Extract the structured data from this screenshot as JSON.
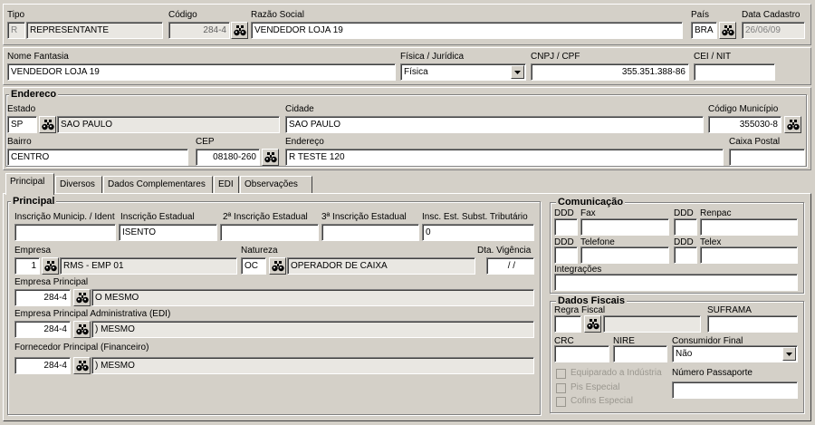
{
  "header": {
    "tipo_label": "Tipo",
    "tipo_code": "R",
    "tipo_value": "REPRESENTANTE",
    "codigo_label": "Código",
    "codigo_value": "284-4",
    "razao_label": "Razão Social",
    "razao_value": "VENDEDOR LOJA 19",
    "pais_label": "País",
    "pais_value": "BRA",
    "data_cadastro_label": "Data Cadastro",
    "data_cadastro_value": "26/06/09"
  },
  "row2": {
    "fantasia_label": "Nome Fantasia",
    "fantasia_value": "VENDEDOR LOJA 19",
    "fisica_label": "Física / Jurídica",
    "fisica_value": "Física",
    "cnpj_label": "CNPJ / CPF",
    "cnpj_value": "355.351.388-86",
    "cei_label": "CEI / NIT",
    "cei_value": ""
  },
  "endereco": {
    "title": "Endereco",
    "estado_label": "Estado",
    "estado_value": "SP",
    "estado_name": "SAO PAULO",
    "cidade_label": "Cidade",
    "cidade_value": "SAO PAULO",
    "cod_municipio_label": "Código Município",
    "cod_municipio_value": "355030-8",
    "bairro_label": "Bairro",
    "bairro_value": "CENTRO",
    "cep_label": "CEP",
    "cep_value": "08180-260",
    "endereco_label": "Endereço",
    "endereco_value": "R TESTE 120",
    "caixa_label": "Caixa Postal",
    "caixa_value": ""
  },
  "tabs": [
    {
      "label": "Principal"
    },
    {
      "label": "Diversos"
    },
    {
      "label": "Dados Complementares"
    },
    {
      "label": "EDI"
    },
    {
      "label": "Observações"
    }
  ],
  "principal": {
    "title": "Principal",
    "insc_municip_label": "Inscrição Municip. / Ident",
    "insc_municip_value": "",
    "insc_estadual_label": "Inscrição Estadual",
    "insc_estadual_value": "ISENTO",
    "insc2_label": "2ª Inscrição Estadual",
    "insc2_value": "",
    "insc3_label": "3ª Inscrição Estadual",
    "insc3_value": "",
    "insc_st_label": "Insc. Est. Subst. Tributário",
    "insc_st_value": "0",
    "empresa_label": "Empresa",
    "empresa_code": "1",
    "empresa_name": "RMS - EMP 01",
    "natureza_label": "Natureza",
    "natureza_code": "OC",
    "natureza_name": "OPERADOR DE CAIXA",
    "vigencia_label": "Dta. Vigência",
    "vigencia_value": " / /",
    "emp_principal_label": "Empresa Principal",
    "emp_principal_code": "284-4",
    "emp_principal_name": "O MESMO",
    "emp_admin_label": "Empresa Principal Administrativa (EDI)",
    "emp_admin_code": "284-4",
    "emp_admin_name": ") MESMO",
    "fornecedor_label": "Fornecedor Principal (Financeiro)",
    "fornecedor_code": "284-4",
    "fornecedor_name": ") MESMO"
  },
  "comunicacao": {
    "title": "Comunicação",
    "ddd_label": "DDD",
    "fax_label": "Fax",
    "renpac_label": "Renpac",
    "telefone_label": "Telefone",
    "telex_label": "Telex",
    "integracoes_label": "Integrações"
  },
  "fiscais": {
    "title": "Dados Fiscais",
    "regra_label": "Regra Fiscal",
    "suframa_label": "SUFRAMA",
    "crc_label": "CRC",
    "nire_label": "NIRE",
    "consumidor_label": "Consumidor Final",
    "consumidor_value": "Não",
    "equiparado_label": "Equiparado a Indústria",
    "pis_label": "Pis Especial",
    "cofins_label": "Cofins Especial",
    "passaporte_label": "Número Passaporte"
  }
}
